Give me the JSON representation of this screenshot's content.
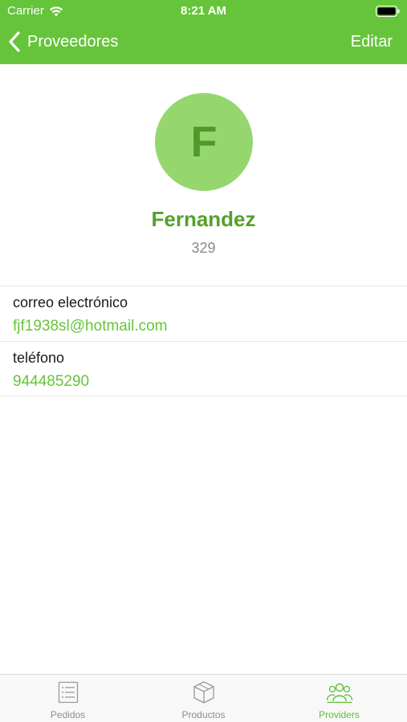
{
  "status_bar": {
    "carrier": "Carrier",
    "time": "8:21 AM",
    "icons": [
      "wifi-icon",
      "battery-icon"
    ]
  },
  "nav": {
    "back_label": "Proveedores",
    "edit_label": "Editar"
  },
  "profile": {
    "initial": "F",
    "name": "Fernandez",
    "code": "329"
  },
  "details": [
    {
      "label": "correo electrónico",
      "value": "fjf1938sl@hotmail.com"
    },
    {
      "label": "teléfono",
      "value": "944485290"
    }
  ],
  "tabs": [
    {
      "label": "Pedidos",
      "icon": "list-icon",
      "active": false
    },
    {
      "label": "Productos",
      "icon": "box-icon",
      "active": false
    },
    {
      "label": "Providers",
      "icon": "people-icon",
      "active": true
    }
  ],
  "colors": {
    "accent": "#66c43a",
    "avatar_bg": "#95d76e",
    "name": "#55a12b",
    "secondary_text": "#8a8a8a",
    "tab_inactive": "#8e8e93"
  }
}
